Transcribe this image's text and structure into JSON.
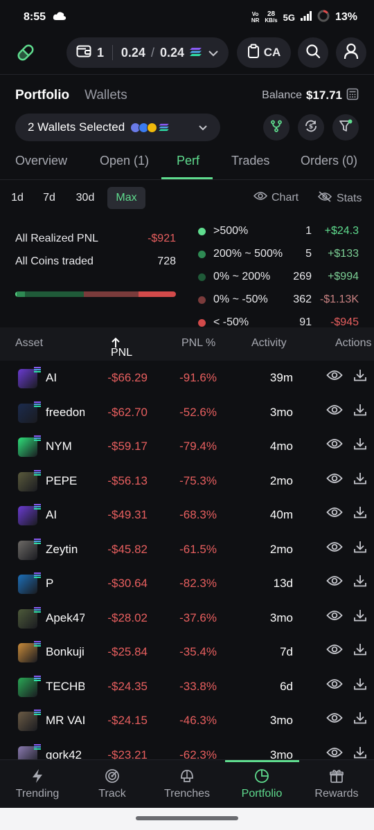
{
  "status_bar": {
    "time": "8:55",
    "volte_top": "Vo",
    "volte_bottom": "NR",
    "speed_value": "28",
    "speed_unit": "KB/s",
    "network": "5G",
    "battery": "13%"
  },
  "header": {
    "wallet_count": "1",
    "sol_balance": "0.24",
    "sol_total": "0.24",
    "ca_label": "CA"
  },
  "portfolio": {
    "tab_portfolio": "Portfolio",
    "tab_wallets": "Wallets",
    "balance_label": "Balance",
    "balance_value": "$17.71",
    "wallets_selected": "2 Wallets Selected"
  },
  "tabs": [
    "Overview",
    "Open (1)",
    "Perf",
    "Trades",
    "Orders (0)"
  ],
  "periods": [
    "1d",
    "7d",
    "30d",
    "Max"
  ],
  "view_links": {
    "chart": "Chart",
    "stats": "Stats"
  },
  "summary": {
    "realized_label": "All Realized PNL",
    "realized_value": "-$921",
    "coins_label": "All Coins traded",
    "coins_value": "728"
  },
  "distribution": [
    {
      "label": ">500%",
      "count": "1",
      "amount": "+$24.3",
      "color": "#5fdc8e",
      "amount_color": "#5fdc8e"
    },
    {
      "label": "200% ~ 500%",
      "count": "5",
      "amount": "+$133",
      "color": "#2e8a53",
      "amount_color": "#7ccf95"
    },
    {
      "label": "0% ~ 200%",
      "count": "269",
      "amount": "+$994",
      "color": "#1f5a38",
      "amount_color": "#7ccf95"
    },
    {
      "label": "0% ~ -50%",
      "count": "362",
      "amount": "-$1.13K",
      "color": "#7a3b3b",
      "amount_color": "#c98282"
    },
    {
      "label": "< -50%",
      "count": "91",
      "amount": "-$945",
      "color": "#d24a4a",
      "amount_color": "#e85f5f"
    }
  ],
  "distribution_bar": [
    {
      "share": 0.0015,
      "color": "#5fdc8e"
    },
    {
      "share": 0.05,
      "color": "#2e8a53"
    },
    {
      "share": 0.37,
      "color": "#1f5a38"
    },
    {
      "share": 0.345,
      "color": "#7a3b3b"
    },
    {
      "share": 0.2335,
      "color": "#d24a4a"
    }
  ],
  "table": {
    "headers": {
      "asset": "Asset",
      "pnl": "PNL",
      "pnl_pct": "PNL %",
      "activity": "Activity",
      "actions": "Actions"
    },
    "rows": [
      {
        "name": "AI",
        "pnl": "-$66.29",
        "pct": "-91.6%",
        "activity": "39m",
        "color": "#6a3bd1"
      },
      {
        "name": "freedom",
        "pnl": "-$62.70",
        "pct": "-52.6%",
        "activity": "3mo",
        "color": "#1b2b4d"
      },
      {
        "name": "NYM",
        "pnl": "-$59.17",
        "pct": "-79.4%",
        "activity": "4mo",
        "color": "#2ee07a"
      },
      {
        "name": "PEPE",
        "pnl": "-$56.13",
        "pct": "-75.3%",
        "activity": "2mo",
        "color": "#5a5a3c"
      },
      {
        "name": "AI",
        "pnl": "-$49.31",
        "pct": "-68.3%",
        "activity": "40m",
        "color": "#6a3bd1"
      },
      {
        "name": "Zeytin",
        "pnl": "-$45.82",
        "pct": "-61.5%",
        "activity": "2mo",
        "color": "#6d6a66"
      },
      {
        "name": "P",
        "pnl": "-$30.64",
        "pct": "-82.3%",
        "activity": "13d",
        "color": "#1d6fb8"
      },
      {
        "name": "Apek47",
        "pnl": "-$28.02",
        "pct": "-37.6%",
        "activity": "3mo",
        "color": "#4d5a3a"
      },
      {
        "name": "Bonkuji",
        "pnl": "-$25.84",
        "pct": "-35.4%",
        "activity": "7d",
        "color": "#c98b3a"
      },
      {
        "name": "TECHBRO",
        "pnl": "-$24.35",
        "pct": "-33.8%",
        "activity": "6d",
        "color": "#2aa855"
      },
      {
        "name": "MR VAI",
        "pnl": "-$24.15",
        "pct": "-46.3%",
        "activity": "3mo",
        "color": "#6b5b45"
      },
      {
        "name": "gork42",
        "pnl": "-$23.21",
        "pct": "-62.3%",
        "activity": "3mo",
        "color": "#8a7ab0"
      }
    ]
  },
  "bottom_nav": [
    "Trending",
    "Track",
    "Trenches",
    "Portfolio",
    "Rewards"
  ]
}
